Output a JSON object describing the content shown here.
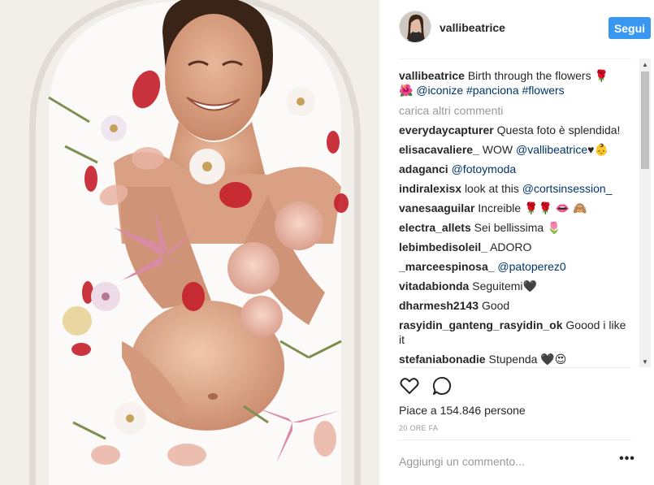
{
  "post": {
    "username": "vallibeatrice",
    "follow_label": "Segui"
  },
  "caption": {
    "username": "vallibeatrice",
    "text": "Birth through the flowers 🌹",
    "line2_emoji": "🌺",
    "tags": "@iconize #panciona #flowers"
  },
  "load_more": "carica altri commenti",
  "comments": [
    {
      "user": "everydaycapturer",
      "text": "Questa foto è splendida!",
      "mention": ""
    },
    {
      "user": "elisacavaliere_",
      "text": "WOW",
      "mention": "@vallibeatrice",
      "after": "♥👶"
    },
    {
      "user": "adaganci",
      "text": "",
      "mention": "@fotoymoda"
    },
    {
      "user": "indiralexisx",
      "text": "look at this",
      "mention": "@cortsinsession_"
    },
    {
      "user": "vanesaaguilar",
      "text": "Increible 🌹🌹 👄 🙈",
      "mention": ""
    },
    {
      "user": "electra_allets",
      "text": "Sei bellissima 🌷",
      "mention": ""
    },
    {
      "user": "lebimbedisoleil_",
      "text": "ADORO",
      "mention": ""
    },
    {
      "user": "_marceespinosa_",
      "text": "",
      "mention": "@patoperez0"
    },
    {
      "user": "vitadabionda",
      "text": "Seguitemi🖤",
      "mention": ""
    },
    {
      "user": "dharmesh2143",
      "text": "Good",
      "mention": ""
    },
    {
      "user": "rasyidin_ganteng_rasyidin_ok",
      "text": "Goood i like it",
      "mention": ""
    },
    {
      "user": "stefaniabonadie",
      "text": "Stupenda 🖤😍",
      "mention": ""
    }
  ],
  "actions": {
    "like_icon": "heart-outline-icon",
    "comment_icon": "speech-bubble-icon"
  },
  "likes_text": "Piace a 154.846 persone",
  "time_ago": "20 ORE FA",
  "comment_placeholder": "Aggiungi un commento...",
  "more_options": "•••",
  "colors": {
    "accent": "#3897f0",
    "mention": "#003569",
    "muted": "#999999",
    "text": "#262626"
  }
}
